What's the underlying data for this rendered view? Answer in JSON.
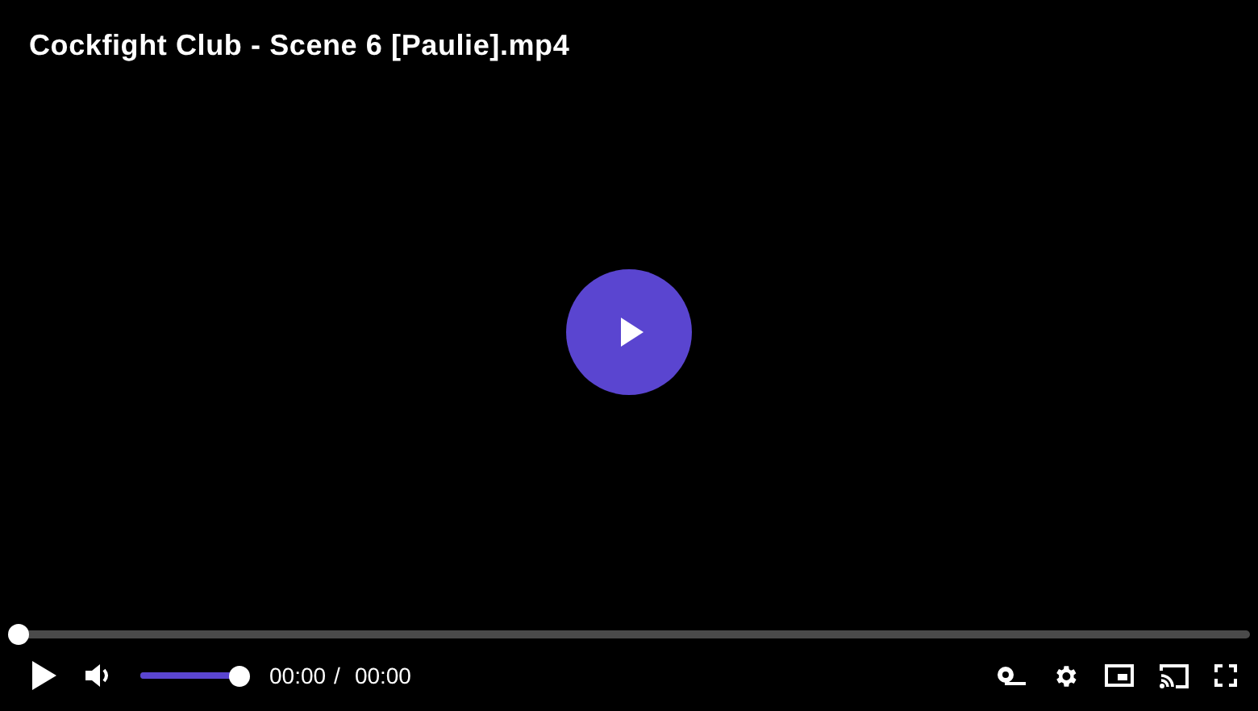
{
  "title": "Cockfight Club - Scene 6 [Paulie].mp4",
  "progress": {
    "level": 0
  },
  "volume": {
    "level": 1
  },
  "time": {
    "current": "00:00",
    "separator": "/",
    "duration": "00:00"
  }
}
